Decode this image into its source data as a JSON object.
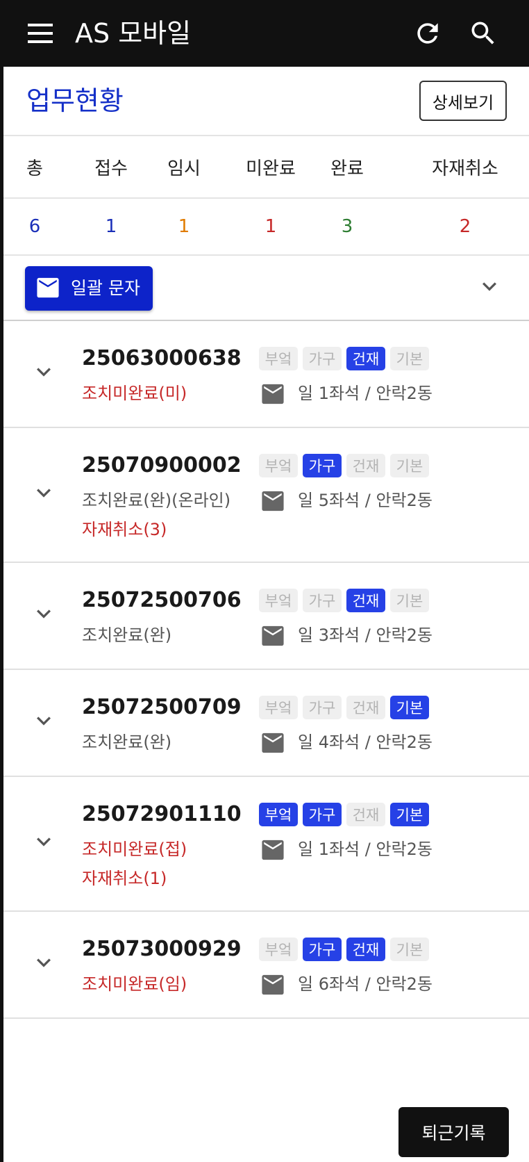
{
  "appbar": {
    "title": "AS 모바일"
  },
  "section": {
    "title": "업무현황",
    "detail_button": "상세보기"
  },
  "summary": {
    "headers": [
      "총",
      "접수",
      "임시",
      "미완료",
      "완료",
      "자재취소"
    ],
    "values": [
      "6",
      "1",
      "1",
      "1",
      "3",
      "2"
    ],
    "colors": [
      "#1a2fb8",
      "#1a2fb8",
      "#e07b00",
      "#c62828",
      "#2e7d32",
      "#c62828"
    ]
  },
  "bulk_sms": {
    "label": "일괄 문자"
  },
  "tag_labels": [
    "부엌",
    "가구",
    "건재",
    "기본"
  ],
  "items": [
    {
      "number": "25063000638",
      "tags": [
        false,
        false,
        true,
        false
      ],
      "status": "조치미완료(미)",
      "status_color": "red",
      "extra": "",
      "location": "일 1좌석 / 안락2동"
    },
    {
      "number": "25070900002",
      "tags": [
        false,
        true,
        false,
        false
      ],
      "status": "조치완료(완)(온라인)",
      "status_color": "gray",
      "extra": "자재취소(3)",
      "location": "일 5좌석 / 안락2동"
    },
    {
      "number": "25072500706",
      "tags": [
        false,
        false,
        true,
        false
      ],
      "status": "조치완료(완)",
      "status_color": "gray",
      "extra": "",
      "location": "일 3좌석 / 안락2동"
    },
    {
      "number": "25072500709",
      "tags": [
        false,
        false,
        false,
        true
      ],
      "status": "조치완료(완)",
      "status_color": "gray",
      "extra": "",
      "location": "일 4좌석 / 안락2동"
    },
    {
      "number": "25072901110",
      "tags": [
        true,
        true,
        false,
        true
      ],
      "status": "조치미완료(접)",
      "status_color": "red",
      "extra": "자재취소(1)",
      "location": "일 1좌석 / 안락2동"
    },
    {
      "number": "25073000929",
      "tags": [
        false,
        true,
        true,
        false
      ],
      "status": "조치미완료(임)",
      "status_color": "red",
      "extra": "",
      "location": "일 6좌석 / 안락2동"
    }
  ],
  "footer": {
    "leave_button": "퇴근기록"
  }
}
